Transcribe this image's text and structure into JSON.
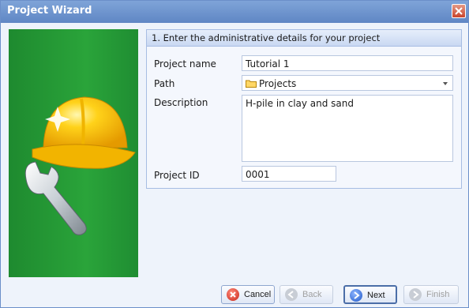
{
  "window": {
    "title": "Project Wizard"
  },
  "step": {
    "header": "1. Enter the administrative details for your project"
  },
  "form": {
    "project_name_label": "Project name",
    "project_name_value": "Tutorial 1",
    "path_label": "Path",
    "path_value": "Projects",
    "description_label": "Description",
    "description_value": "H-pile in clay and sand",
    "project_id_label": "Project ID",
    "project_id_value": "0001"
  },
  "buttons": {
    "cancel": "Cancel",
    "back": "Back",
    "next": "Next",
    "finish": "Finish"
  },
  "colors": {
    "title_bar": "#5f86c4",
    "side_panel": "#2aa43a",
    "close": "#c9442c"
  },
  "icons": [
    "close-icon",
    "hard-hat-wrench-illustration",
    "folder-icon",
    "cancel-icon",
    "back-arrow-icon",
    "next-arrow-icon",
    "finish-icon"
  ]
}
